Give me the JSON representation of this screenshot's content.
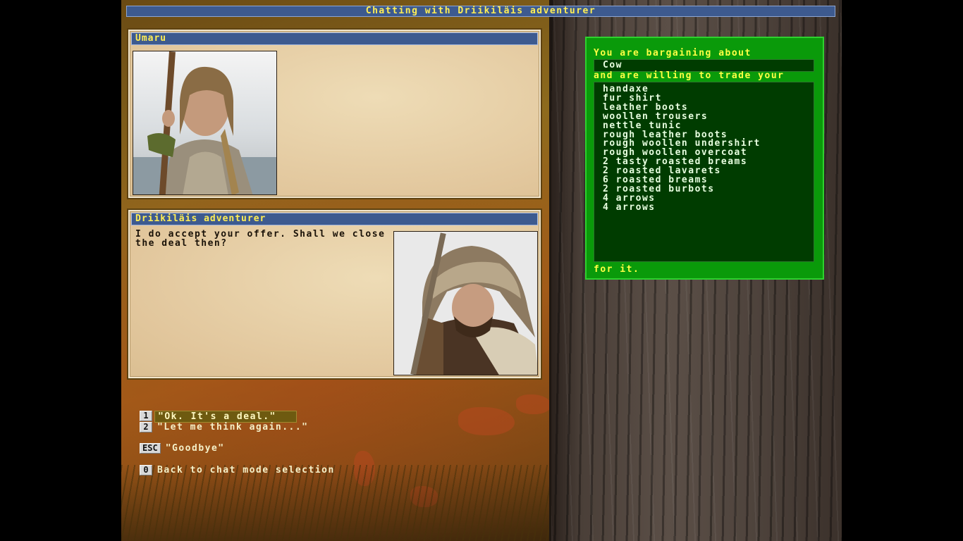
{
  "window": {
    "title": "Chatting with Driikiläis adventurer"
  },
  "player": {
    "name": "Umaru"
  },
  "npc": {
    "name": "Driikiläis adventurer",
    "speech": "I do accept your offer. Shall we close the deal then?"
  },
  "trade": {
    "intro": "You are bargaining about",
    "item": "Cow",
    "middle": "and are willing to trade your",
    "offered_items": [
      "handaxe",
      "fur shirt",
      "leather boots",
      "woollen trousers",
      "nettle tunic",
      "rough leather boots",
      "rough woollen undershirt",
      "rough woollen overcoat",
      "2 tasty roasted breams",
      "2 roasted lavarets",
      "6 roasted breams",
      "2 roasted burbots",
      "4 arrows",
      "4 arrows"
    ],
    "outro": "for it."
  },
  "options": [
    {
      "key": "1",
      "label": "\"Ok. It's a deal.\"",
      "selected": true
    },
    {
      "key": "2",
      "label": "\"Let me think again...\"",
      "selected": false
    },
    {
      "key": "ESC",
      "label": "\"Goodbye\"",
      "selected": false
    },
    {
      "key": "0",
      "label": "Back to chat mode selection",
      "selected": false
    }
  ],
  "colors": {
    "header_blue": "#3d5a8f",
    "header_text": "#ffee55",
    "trade_green": "#0a9a0a",
    "trade_dark": "#003c00"
  }
}
